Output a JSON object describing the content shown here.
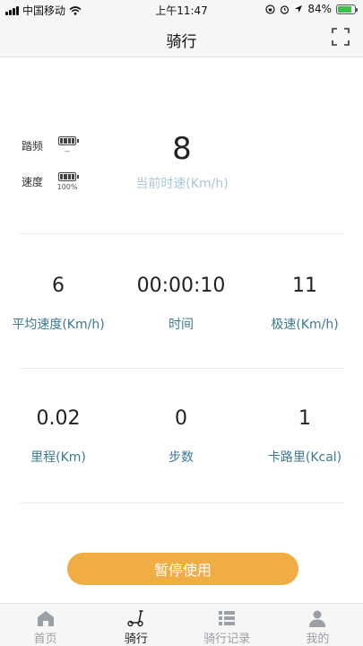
{
  "status_bar": {
    "carrier": "中国移动",
    "time": "上午11:47",
    "battery_pct": "84%",
    "battery_level": 0.84
  },
  "nav": {
    "title": "骑行"
  },
  "indicators": {
    "cadence_label": "踏频",
    "cadence_value": "--",
    "speed_label": "速度",
    "speed_value": "100%"
  },
  "current_speed": {
    "value": "8",
    "label": "当前时速(Km/h)"
  },
  "stats_row1": {
    "avg_speed": {
      "value": "6",
      "label": "平均速度(Km/h)"
    },
    "time": {
      "value": "00:00:10",
      "label": "时间"
    },
    "max_speed": {
      "value": "11",
      "label": "极速(Km/h)"
    }
  },
  "stats_row2": {
    "distance": {
      "value": "0.02",
      "label": "里程(Km)"
    },
    "steps": {
      "value": "0",
      "label": "步数"
    },
    "calories": {
      "value": "1",
      "label": "卡路里(Kcal)"
    }
  },
  "pause_button": "暂停使用",
  "tabs": [
    {
      "label": "首页",
      "icon": "home-icon"
    },
    {
      "label": "骑行",
      "icon": "scooter-icon"
    },
    {
      "label": "骑行记录",
      "icon": "list-icon"
    },
    {
      "label": "我的",
      "icon": "person-icon"
    }
  ],
  "colors": {
    "accent": "#efad44",
    "label_teal": "#3c7a90",
    "speed_label": "#a9c9d4"
  }
}
